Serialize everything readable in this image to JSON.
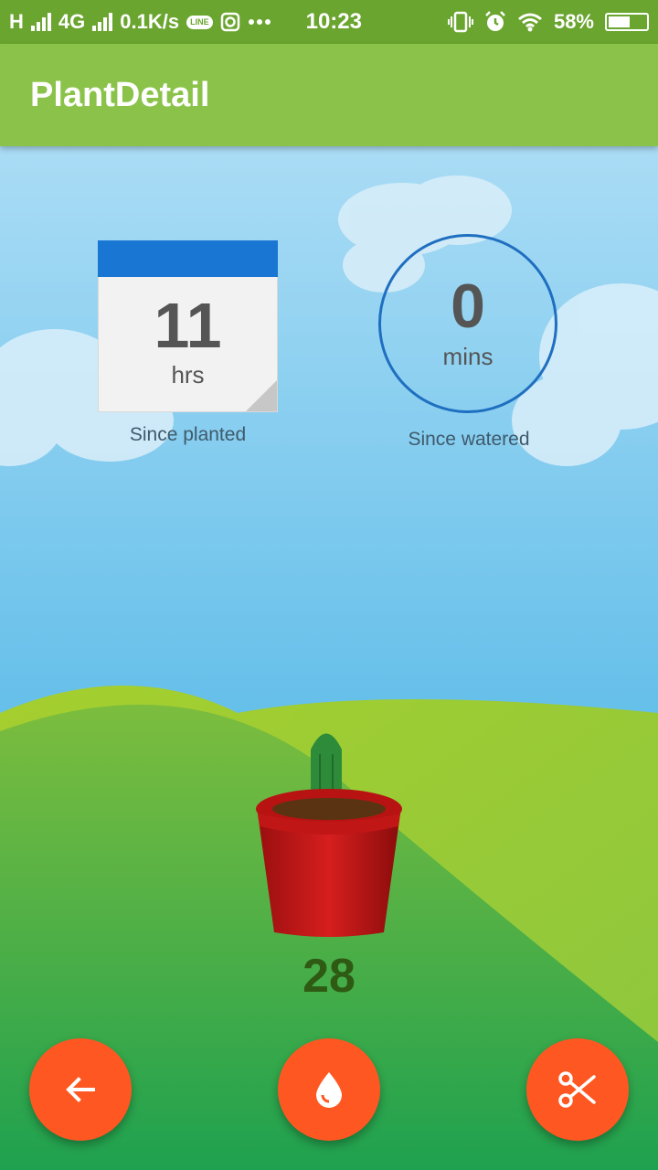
{
  "status_bar": {
    "network_type": "H",
    "network_type_2": "4G",
    "speed": "0.1K/s",
    "line_badge": "LINE",
    "time": "10:23",
    "battery": "58%",
    "battery_level": 0.58,
    "icons": [
      "signal-icon",
      "line-app-icon",
      "instagram-icon",
      "more-dots-icon",
      "vibrate-icon",
      "alarm-icon",
      "wifi-icon",
      "battery-icon"
    ]
  },
  "app_bar": {
    "title": "PlantDetail"
  },
  "planted": {
    "value": "11",
    "unit": "hrs",
    "caption": "Since planted"
  },
  "watered": {
    "value": "0",
    "unit": "mins",
    "caption": "Since watered"
  },
  "plant": {
    "count": "28"
  },
  "actions": {
    "back_icon": "arrow-back-icon",
    "water_icon": "water-drop-icon",
    "cut_icon": "scissors-icon"
  },
  "colors": {
    "status_bar": "#6aa52f",
    "app_bar": "#8bc34a",
    "fab": "#ff5722",
    "calendar_header": "#1976d2",
    "ring": "#1f6fc0",
    "count_text": "#2e5a14"
  }
}
